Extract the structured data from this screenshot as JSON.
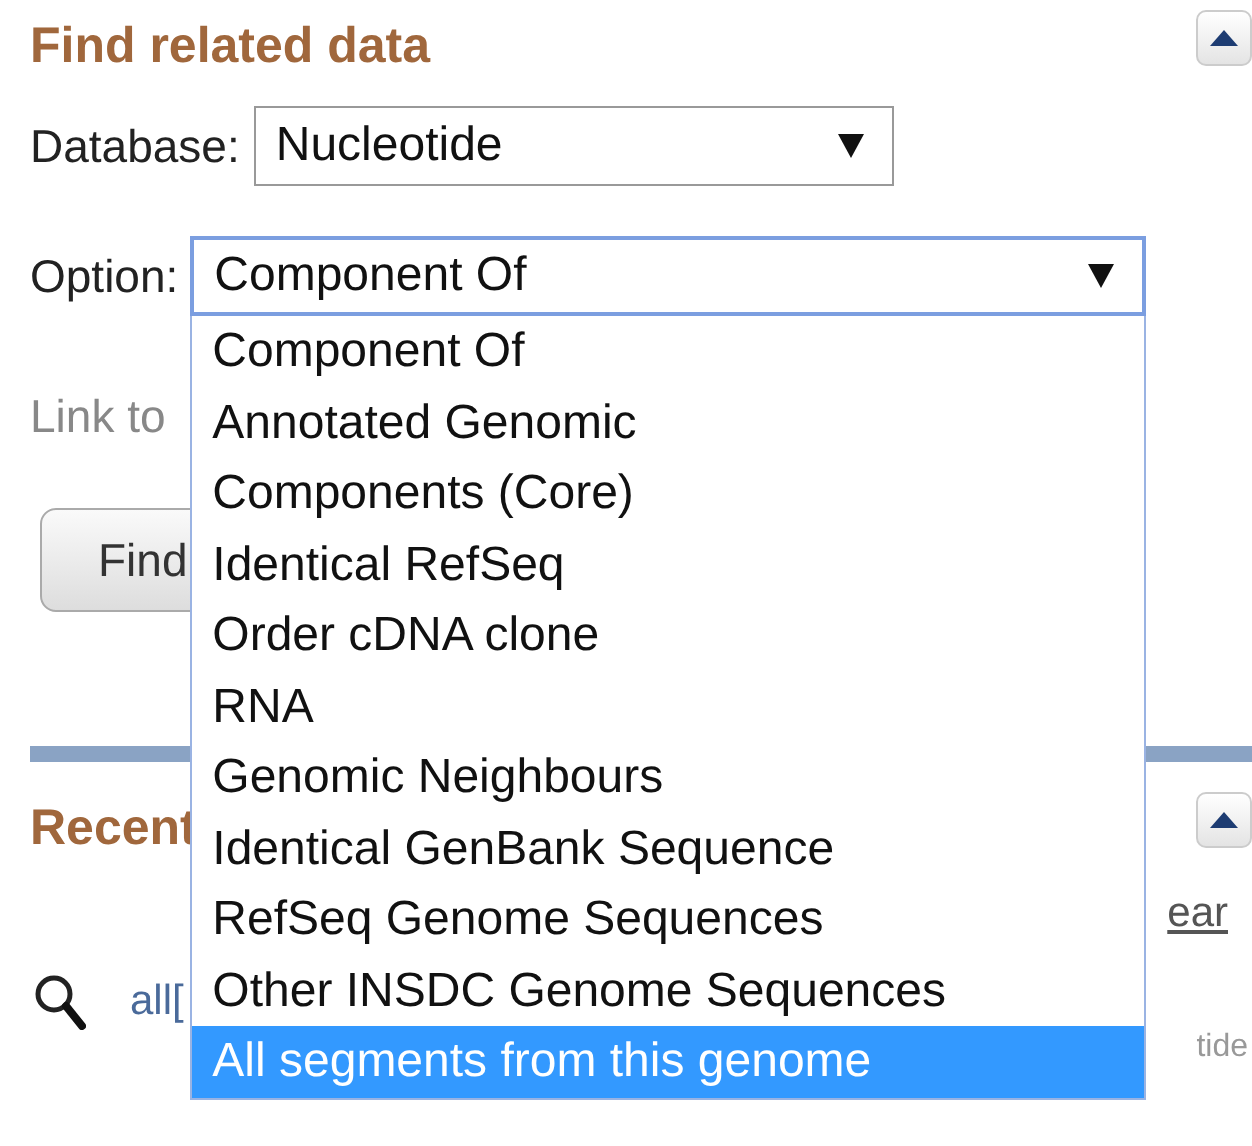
{
  "find_related": {
    "title": "Find related data",
    "database": {
      "label": "Database:",
      "value": "Nucleotide"
    },
    "option": {
      "label": "Option:",
      "value": "Component Of",
      "expanded": true,
      "options": [
        {
          "label": "Component Of",
          "highlighted": false
        },
        {
          "label": "Annotated Genomic",
          "highlighted": false
        },
        {
          "label": "Components (Core)",
          "highlighted": false
        },
        {
          "label": "Identical RefSeq",
          "highlighted": false
        },
        {
          "label": "Order cDNA clone",
          "highlighted": false
        },
        {
          "label": "RNA",
          "highlighted": false
        },
        {
          "label": "Genomic Neighbours",
          "highlighted": false
        },
        {
          "label": "Identical GenBank Sequence",
          "highlighted": false
        },
        {
          "label": "RefSeq Genome Sequences",
          "highlighted": false
        },
        {
          "label": "Other INSDC Genome Sequences",
          "highlighted": false
        },
        {
          "label": "All segments from this genome",
          "highlighted": true
        }
      ]
    },
    "link_text": "Link to",
    "find_button": "Find"
  },
  "recent": {
    "title": "Recent",
    "clear_link": "ear",
    "history": [
      {
        "query": "all[",
        "database": "tide"
      }
    ]
  }
}
